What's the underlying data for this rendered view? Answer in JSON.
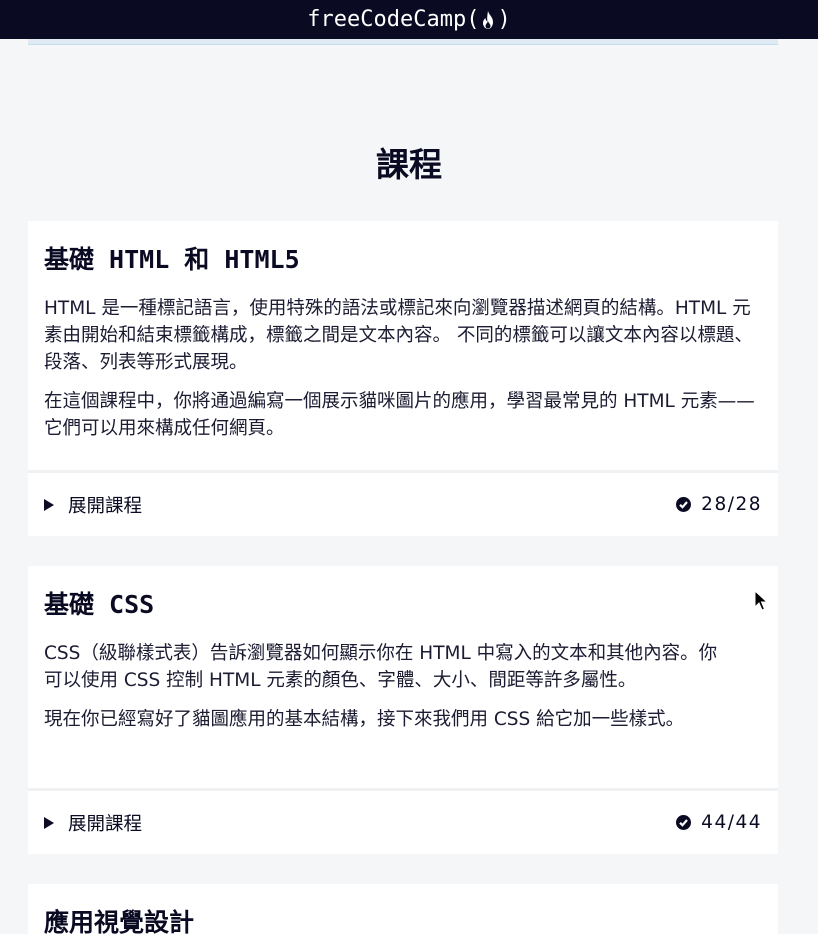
{
  "navbar": {
    "brand_left": "freeCodeCamp(",
    "brand_right": ")",
    "brand_icon": "flame-icon"
  },
  "page": {
    "title": "課程"
  },
  "courses": [
    {
      "title": "基礎 HTML 和 HTML5",
      "paragraphs": [
        "HTML 是一種標記語言，使用特殊的語法或標記來向瀏覽器描述網頁的結構。HTML 元素由開始和結束標籤構成，標籤之間是文本內容。 不同的標籤可以讓文本內容以標題、段落、列表等形式展現。",
        "在這個課程中，你將通過編寫一個展示貓咪圖片的應用，學習最常見的 HTML 元素——它們可以用來構成任何網頁。"
      ],
      "expand_label": "展開課程",
      "progress": "28/28"
    },
    {
      "title": "基礎 CSS",
      "paragraphs": [
        "CSS（級聯樣式表）告訴瀏覽器如何顯示你在 HTML 中寫入的文本和其他內容。你可以使用 CSS 控制 HTML 元素的顏色、字體、大小、間距等許多屬性。",
        "現在你已經寫好了貓圖應用的基本結構，接下來我們用 CSS 給它加一些樣式。"
      ],
      "expand_label": "展開課程",
      "progress": "44/44"
    },
    {
      "title": "應用視覺設計"
    }
  ],
  "colors": {
    "nav_bg": "#0a0a23",
    "page_bg": "#f5f6f7",
    "card_bg": "#ffffff",
    "text": "#0a0a23"
  }
}
